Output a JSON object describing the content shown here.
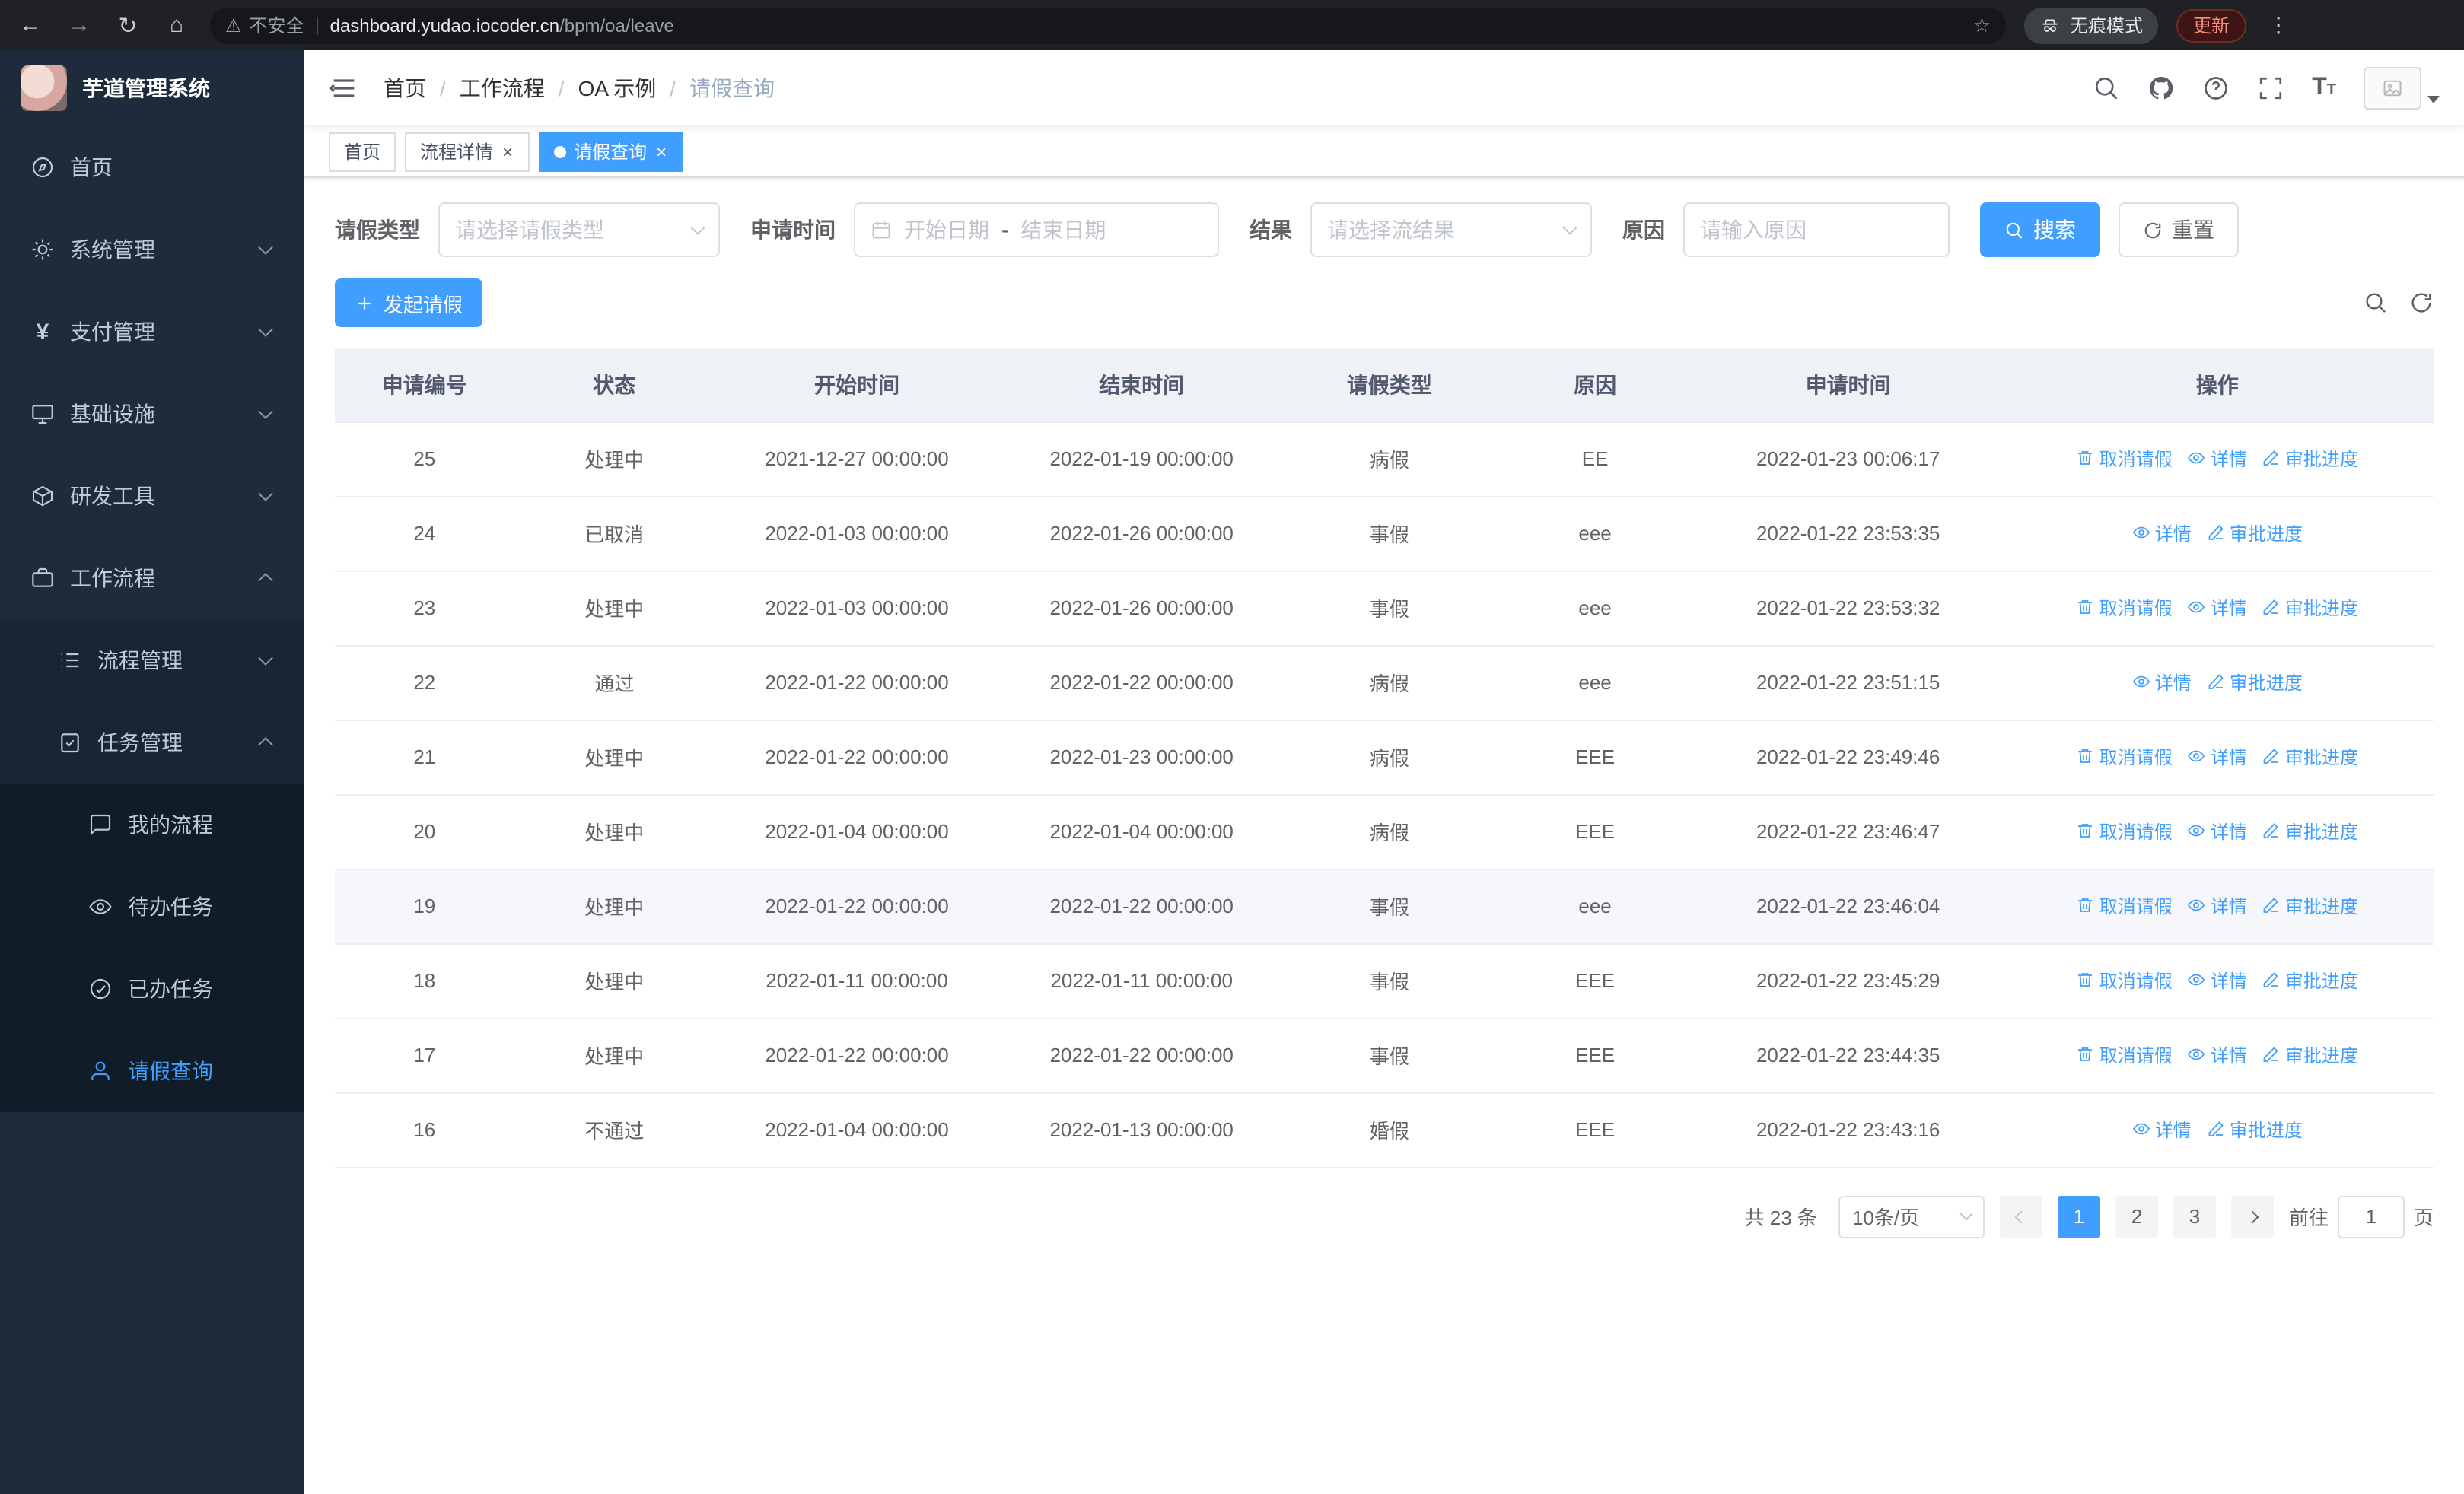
{
  "browser": {
    "security_label": "不安全",
    "url_host": "dashboard.yudao.iocoder.cn",
    "url_path": "/bpm/oa/leave",
    "incognito_label": "无痕模式",
    "update_label": "更新"
  },
  "sidebar": {
    "app_title": "芋道管理系统",
    "items": [
      {
        "label": "首页"
      },
      {
        "label": "系统管理"
      },
      {
        "label": "支付管理"
      },
      {
        "label": "基础设施"
      },
      {
        "label": "研发工具"
      },
      {
        "label": "工作流程"
      }
    ],
    "workflow_children": [
      {
        "label": "流程管理"
      },
      {
        "label": "任务管理"
      }
    ],
    "task_children": [
      {
        "label": "我的流程"
      },
      {
        "label": "待办任务"
      },
      {
        "label": "已办任务"
      },
      {
        "label": "请假查询"
      }
    ]
  },
  "header": {
    "breadcrumb": [
      "首页",
      "工作流程",
      "OA 示例",
      "请假查询"
    ]
  },
  "tabs": [
    {
      "label": "首页"
    },
    {
      "label": "流程详情"
    },
    {
      "label": "请假查询"
    }
  ],
  "filters": {
    "leave_type_label": "请假类型",
    "leave_type_placeholder": "请选择请假类型",
    "apply_time_label": "申请时间",
    "start_date_placeholder": "开始日期",
    "range_separator": "-",
    "end_date_placeholder": "结束日期",
    "result_label": "结果",
    "result_placeholder": "请选择流结果",
    "reason_label": "原因",
    "reason_placeholder": "请输入原因",
    "search_label": "搜索",
    "reset_label": "重置"
  },
  "toolbar": {
    "create_label": "发起请假"
  },
  "table": {
    "columns": [
      "申请编号",
      "状态",
      "开始时间",
      "结束时间",
      "请假类型",
      "原因",
      "申请时间",
      "操作"
    ],
    "action_labels": {
      "cancel": "取消请假",
      "detail": "详情",
      "progress": "审批进度"
    },
    "rows": [
      {
        "id": "25",
        "status": "处理中",
        "start": "2021-12-27 00:00:00",
        "end": "2022-01-19 00:00:00",
        "type": "病假",
        "reason": "EE",
        "applied": "2022-01-23 00:06:17",
        "actions": [
          "cancel",
          "detail",
          "progress"
        ]
      },
      {
        "id": "24",
        "status": "已取消",
        "start": "2022-01-03 00:00:00",
        "end": "2022-01-26 00:00:00",
        "type": "事假",
        "reason": "eee",
        "applied": "2022-01-22 23:53:35",
        "actions": [
          "detail",
          "progress"
        ]
      },
      {
        "id": "23",
        "status": "处理中",
        "start": "2022-01-03 00:00:00",
        "end": "2022-01-26 00:00:00",
        "type": "事假",
        "reason": "eee",
        "applied": "2022-01-22 23:53:32",
        "actions": [
          "cancel",
          "detail",
          "progress"
        ]
      },
      {
        "id": "22",
        "status": "通过",
        "start": "2022-01-22 00:00:00",
        "end": "2022-01-22 00:00:00",
        "type": "病假",
        "reason": "eee",
        "applied": "2022-01-22 23:51:15",
        "actions": [
          "detail",
          "progress"
        ]
      },
      {
        "id": "21",
        "status": "处理中",
        "start": "2022-01-22 00:00:00",
        "end": "2022-01-23 00:00:00",
        "type": "病假",
        "reason": "EEE",
        "applied": "2022-01-22 23:49:46",
        "actions": [
          "cancel",
          "detail",
          "progress"
        ]
      },
      {
        "id": "20",
        "status": "处理中",
        "start": "2022-01-04 00:00:00",
        "end": "2022-01-04 00:00:00",
        "type": "病假",
        "reason": "EEE",
        "applied": "2022-01-22 23:46:47",
        "actions": [
          "cancel",
          "detail",
          "progress"
        ]
      },
      {
        "id": "19",
        "status": "处理中",
        "start": "2022-01-22 00:00:00",
        "end": "2022-01-22 00:00:00",
        "type": "事假",
        "reason": "eee",
        "applied": "2022-01-22 23:46:04",
        "actions": [
          "cancel",
          "detail",
          "progress"
        ],
        "highlight": true
      },
      {
        "id": "18",
        "status": "处理中",
        "start": "2022-01-11 00:00:00",
        "end": "2022-01-11 00:00:00",
        "type": "事假",
        "reason": "EEE",
        "applied": "2022-01-22 23:45:29",
        "actions": [
          "cancel",
          "detail",
          "progress"
        ]
      },
      {
        "id": "17",
        "status": "处理中",
        "start": "2022-01-22 00:00:00",
        "end": "2022-01-22 00:00:00",
        "type": "事假",
        "reason": "EEE",
        "applied": "2022-01-22 23:44:35",
        "actions": [
          "cancel",
          "detail",
          "progress"
        ]
      },
      {
        "id": "16",
        "status": "不通过",
        "start": "2022-01-04 00:00:00",
        "end": "2022-01-13 00:00:00",
        "type": "婚假",
        "reason": "EEE",
        "applied": "2022-01-22 23:43:16",
        "actions": [
          "detail",
          "progress"
        ]
      }
    ]
  },
  "pagination": {
    "total_label": "共 23 条",
    "page_size_label": "10条/页",
    "pages": [
      "1",
      "2",
      "3"
    ],
    "goto_label": "前往",
    "goto_value": "1",
    "page_label": "页"
  },
  "colors": {
    "accent": "#409eff",
    "sidebar_bg": "#1d2b3a"
  }
}
